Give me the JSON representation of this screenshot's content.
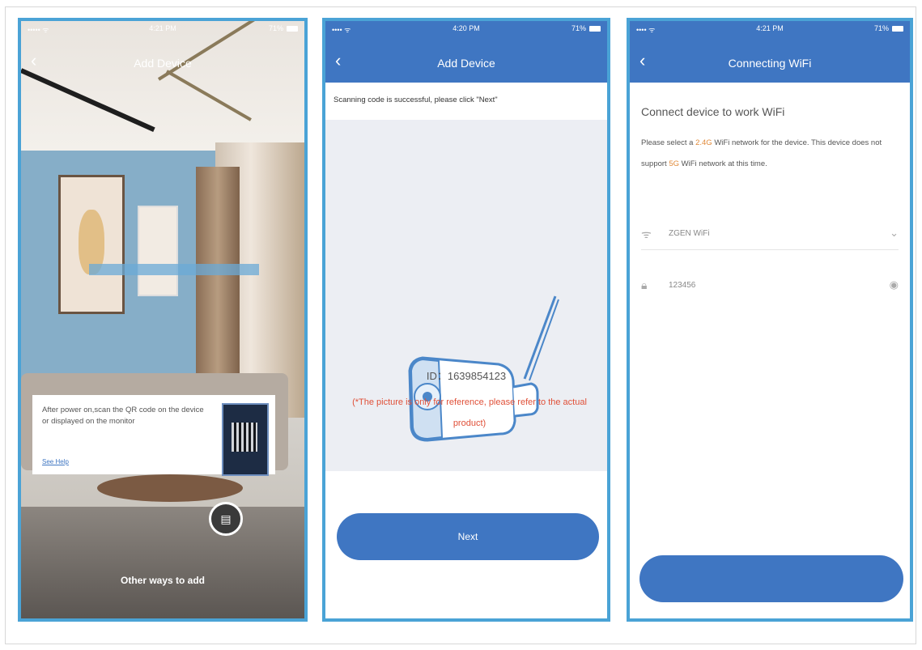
{
  "screen1": {
    "title": "Add Device",
    "status_left": "••••• ᯤ",
    "status_time": "4:21 PM",
    "status_right": "71%",
    "hint_text": "After power on,scan the QR code on the device or displayed on the monitor",
    "hint_link": "See Help",
    "other_ways": "Other ways to add"
  },
  "screen2": {
    "status_left": "•••• ᯤ",
    "status_time": "4:20 PM",
    "status_right": "71%",
    "back": "‹",
    "title": "Add Device",
    "message": "Scanning code is successful, please click \"Next\"",
    "device_id": "ID：1639854123",
    "note": "(*The picture is only for reference, please refer to the actual product)",
    "next_label": "Next"
  },
  "screen3": {
    "status_left": "•••• ᯤ",
    "status_time": "4:21 PM",
    "status_right": "71%",
    "back": "‹",
    "title": "Connecting WiFi",
    "heading": "Connect device to work WiFi",
    "desc_a": "Please select a ",
    "desc_hl1": "2.4G",
    "desc_b": " WiFi network for the device. This device does not support ",
    "desc_hl2": "5G",
    "desc_c": " WiFi network at this time.",
    "wifi_value": "ZGEN WiFi",
    "password_value": "123456",
    "next_label": ""
  },
  "colors": {
    "accent": "#3f76c2",
    "border": "#4aa3d6",
    "warn": "#e05038"
  }
}
